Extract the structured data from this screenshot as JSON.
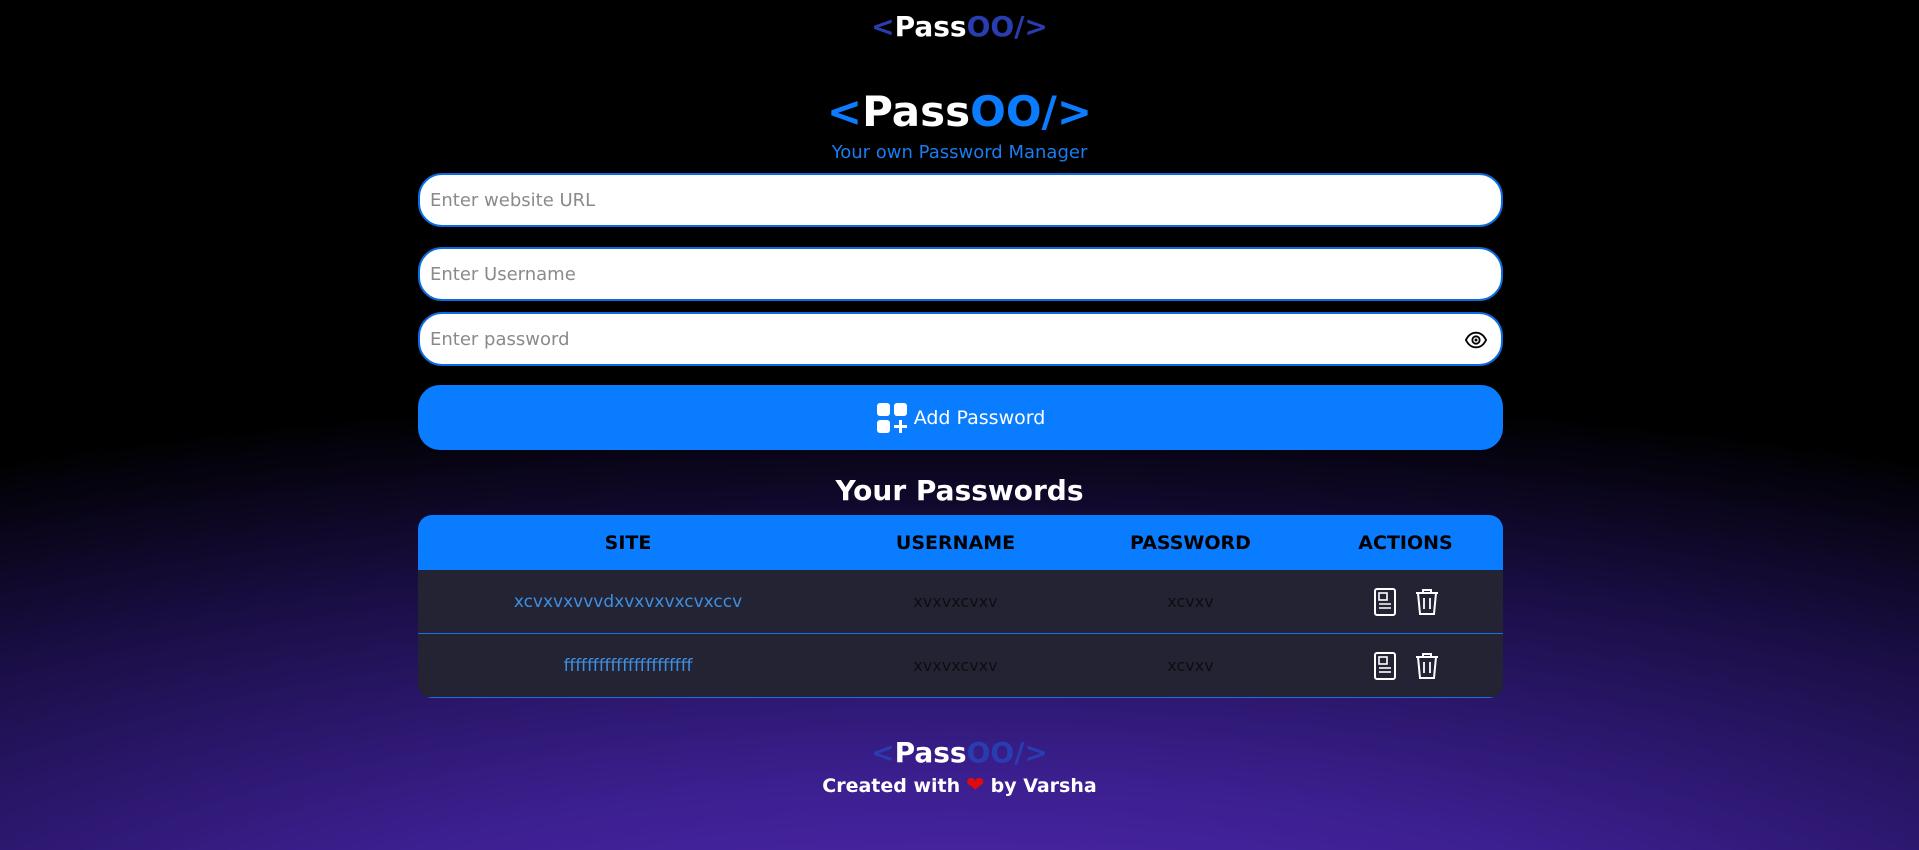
{
  "navbar": {
    "logo": {
      "open": "<",
      "pass": "Pass",
      "oo": "OO",
      "close": "/>"
    }
  },
  "hero": {
    "logo": {
      "open": "<",
      "pass": "Pass",
      "oo": "OO",
      "close": "/>"
    },
    "tagline": "Your own Password Manager"
  },
  "form": {
    "site_placeholder": "Enter website URL",
    "site_value": "",
    "username_placeholder": "Enter Username",
    "username_value": "",
    "password_placeholder": "Enter password",
    "password_value": "",
    "show_password_icon": "eye-icon",
    "add_button_label": "Add Password",
    "add_button_icon": "add-grid-icon"
  },
  "passwords": {
    "title": "Your Passwords",
    "headers": [
      "SITE",
      "USERNAME",
      "PASSWORD",
      "ACTIONS"
    ],
    "rows": [
      {
        "site": "xcvxvxvvvdxvxvxvxcvxccv",
        "username": "xvxvxcvxv",
        "password": "xcvxv"
      },
      {
        "site": "ffffffffffffffffffffff",
        "username": "xvxvxcvxv",
        "password": "xcvxv"
      }
    ],
    "row_action_icons": [
      "copy-document-icon",
      "trash-icon"
    ]
  },
  "footer": {
    "logo": {
      "open": "<",
      "pass": "Pass",
      "oo": "OO",
      "close": "/>"
    },
    "credit_before": "Created with",
    "credit_heart": "❤",
    "credit_after": "by Varsha"
  },
  "colors": {
    "accent": "#0a7cff",
    "table_row_bg": "#232334",
    "site_link": "#3f8fe0",
    "heart": "#e00b0b"
  }
}
